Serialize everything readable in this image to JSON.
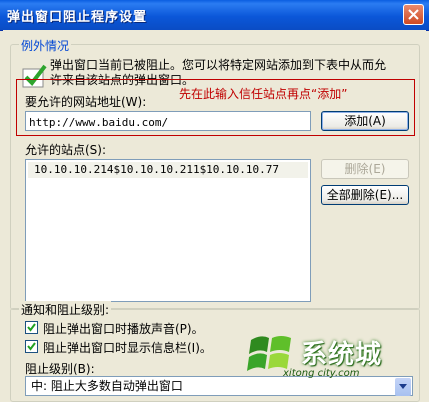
{
  "window": {
    "title": "弹出窗口阻止程序设置"
  },
  "exceptions": {
    "legend": "例外情况",
    "info_line1": "弹出窗口当前已被阻止。您可以将特定网站添加到下表中从而允",
    "info_line2": "许来自该站点的弹出窗口。",
    "address_label": "要允许的网站地址(W):",
    "hint": "先在此输入信任站点再点“添加”",
    "address_value": "http://www.baidu.com/",
    "add_button": "添加(A)",
    "allowed_label": "允许的站点(S):",
    "allowed_sites": [
      "10.10.10.214$10.10.10.211$10.10.10.77"
    ],
    "remove_button": "删除(E)",
    "remove_all_button": "全部删除(E)..."
  },
  "notify": {
    "legend": "通知和阻止级别:",
    "sound_label": "阻止弹出窗口时播放声音(P)。",
    "sound_checked": true,
    "infobar_label": "阻止弹出窗口时显示信息栏(I)。",
    "infobar_checked": true,
    "level_label": "阻止级别(B):",
    "level_value": "中: 阻止大多数自动弹出窗口"
  },
  "watermark": {
    "main": "系统城",
    "sub": "xitong city.com"
  },
  "colors": {
    "title_bar": "#0a57d9",
    "hint_red": "#c00000",
    "group_label_blue": "#0046d5"
  }
}
